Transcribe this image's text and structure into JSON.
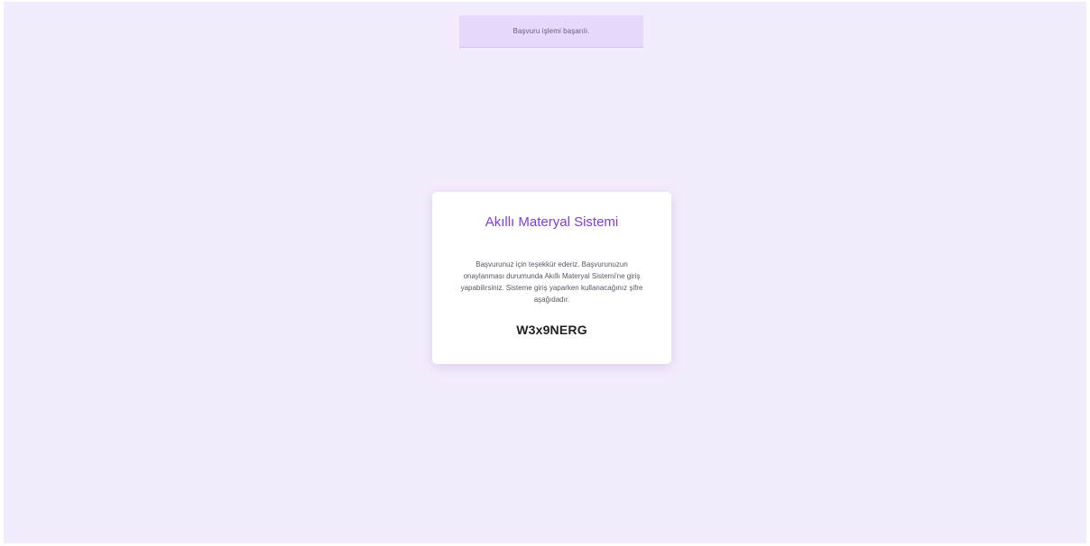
{
  "toast": {
    "message": "Başvuru işlemi başarılı."
  },
  "card": {
    "title": "Akıllı Materyal Sistemi",
    "message": "Başvurunuz için teşekkür ederiz. Başvurunuzun onaylanması durumunda Akıllı Materyal Sistemi'ne giriş yapabilirsiniz. Sisteme giriş yaparken kullanacağınız şifre aşağıdadır.",
    "code": "W3x9NERG"
  },
  "colors": {
    "background": "#f3ecfd",
    "toast_background": "#e6d9fb",
    "title_accent": "#7b3fd6"
  }
}
